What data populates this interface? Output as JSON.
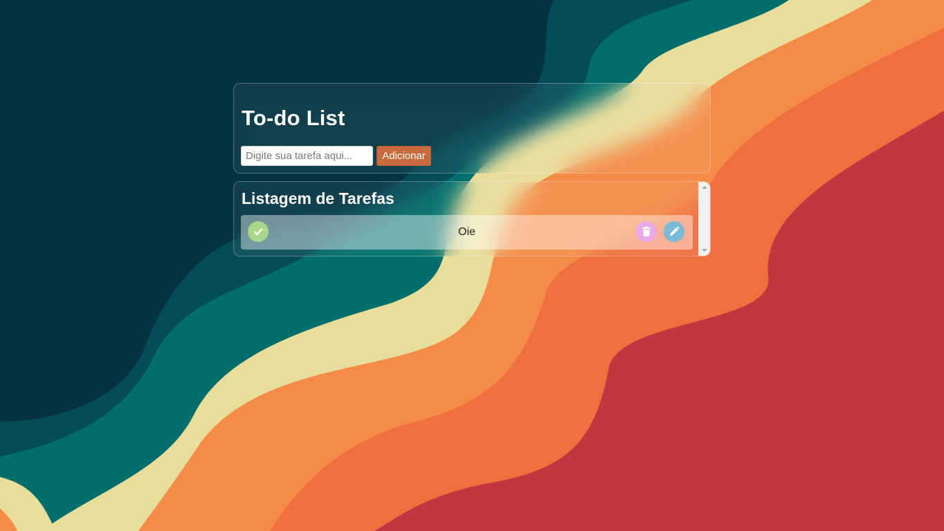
{
  "colors": {
    "bg_deep": "#033341",
    "bg_teal_dark": "#044c58",
    "bg_teal": "#006f6b",
    "bg_cream": "#e8dd9b",
    "bg_orange": "#f48c48",
    "bg_orange_dark": "#ef6f3e",
    "bg_red": "#c43540",
    "add_button": "#c76a3c",
    "complete_button": "#a8d98a",
    "delete_button": "#e9a8e6",
    "edit_button": "#7bbad6"
  },
  "header": {
    "title": "To-do List"
  },
  "form": {
    "input_placeholder": "Digite sua tarefa aqui...",
    "input_value": "",
    "add_label": "Adicionar"
  },
  "list": {
    "title": "Listagem de Tarefas",
    "tasks": [
      {
        "text": "Oie",
        "complete_icon": "check-icon",
        "delete_icon": "trash-icon",
        "edit_icon": "pencil-icon"
      }
    ]
  }
}
